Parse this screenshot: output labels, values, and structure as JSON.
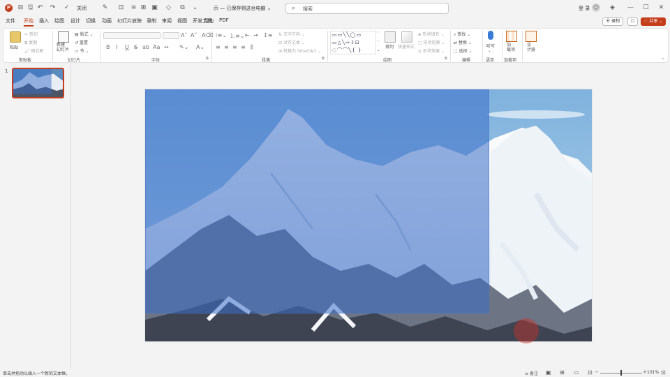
{
  "titlebar": {
    "app_logo": "P",
    "autosave_label": "关闭",
    "doc_title": "示 — 已保存到这台电脑 ⌄",
    "search_placeholder": "搜索",
    "user_name": "登 录",
    "avatar_glyph": "☺",
    "window": {
      "minimize": "—",
      "maximize": "☐",
      "close": "✕"
    }
  },
  "tabs": [
    "文件",
    "开始",
    "插入",
    "绘图",
    "设计",
    "切换",
    "动画",
    "幻灯片放映",
    "录制",
    "审阅",
    "视图",
    "开发工具",
    "帮助",
    "PDF"
  ],
  "tab_active_index": 1,
  "tab_actions": {
    "record": "⦿ 录制",
    "comments": "☐",
    "share": "☞ 共享 ⌄"
  },
  "ribbon": {
    "clipboard": {
      "paste": "粘贴",
      "cut": "剪切",
      "copy": "复制",
      "format_painter": "格式刷",
      "label": "剪贴板"
    },
    "slides": {
      "new_slide": "新建\n幻灯片",
      "layout": "版式",
      "reset": "重置",
      "section": "节",
      "label": "幻灯片"
    },
    "font": {
      "bold": "B",
      "italic": "I",
      "underline": "U",
      "strike": "S",
      "label": "字体"
    },
    "paragraph": {
      "text_direction": "文字方向",
      "align_text": "对齐文本",
      "smartart": "转换为 SmartArt",
      "label": "段落"
    },
    "drawing": {
      "arrange": "排列",
      "quick_styles": "快速样式",
      "fill": "形状填充",
      "outline": "形状轮廓",
      "effects": "形状效果",
      "label": "绘图"
    },
    "editing": {
      "find": "查找",
      "replace": "替换",
      "select": "选择",
      "label": "编辑"
    },
    "voice": {
      "dictate": "听写",
      "label": "语音"
    },
    "addins": {
      "addins": "加\n载项",
      "label": "加载项"
    },
    "design": {
      "designer": "设\n计器"
    }
  },
  "slide_panel": {
    "slide_number": "1"
  },
  "statusbar": {
    "text": "单击并拖动以插入一个新的文本框。",
    "notes": "备注",
    "zoom_minus": "−",
    "zoom_plus": "+",
    "zoom_level": "101%"
  },
  "colors": {
    "accent": "#c43e1c",
    "overlay": "#3a6ec8"
  }
}
